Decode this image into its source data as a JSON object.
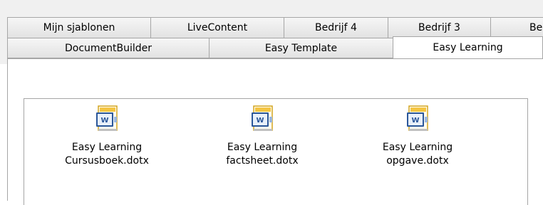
{
  "tabs": {
    "back_row": [
      "Mijn sjablonen",
      "LiveContent",
      "Bedrijf 4",
      "Bedrijf 3",
      "Bedr"
    ],
    "front_row": [
      "DocumentBuilder",
      "Easy Template",
      "Easy Learning"
    ],
    "active": "Easy Learning"
  },
  "files": [
    {
      "line1": "Easy Learning",
      "line2": "Cursusboek.dotx",
      "icon": "word-template-icon"
    },
    {
      "line1": "Easy Learning",
      "line2": "factsheet.dotx",
      "icon": "word-template-icon"
    },
    {
      "line1": "Easy Learning",
      "line2": "opgave.dotx",
      "icon": "word-template-icon"
    }
  ]
}
